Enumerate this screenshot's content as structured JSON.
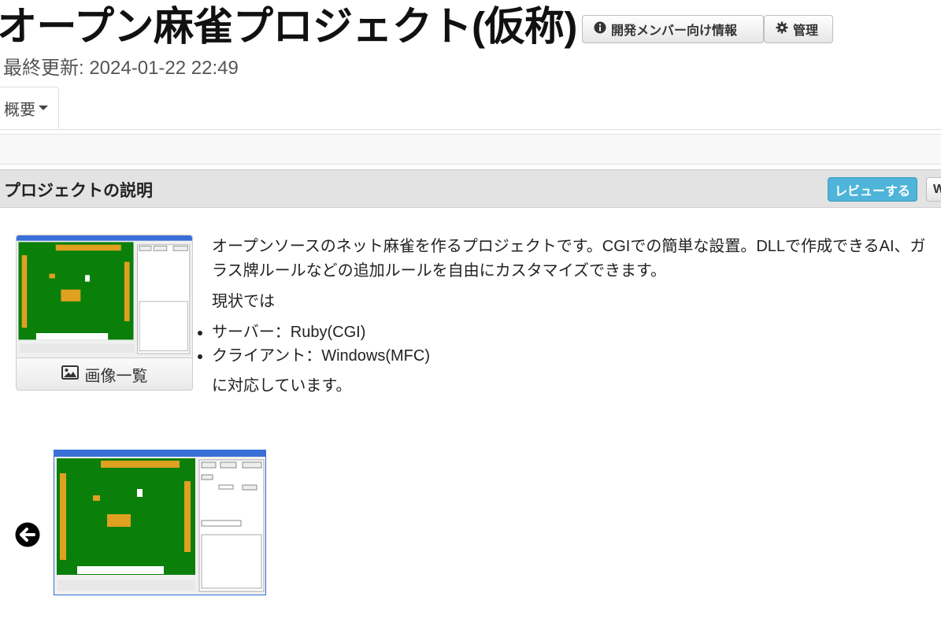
{
  "header": {
    "title": "オープン麻雀プロジェクト(仮称)",
    "dev_info_label": "開発メンバー向け情報",
    "admin_label": "管理",
    "last_updated": "最終更新: 2024-01-22 22:49"
  },
  "tabs": [
    {
      "label": "概要"
    }
  ],
  "panel": {
    "title": "プロジェクトの説明",
    "review_label": "レビューする",
    "w_label": "W"
  },
  "thumbnail": {
    "gallery_label": "画像一覧"
  },
  "description": {
    "para1": "オープンソースのネット麻雀を作るプロジェクトです。CGIでの簡単な設置。DLLで作成できるAI、ガラス牌ルールなどの追加ルールを自由にカスタマイズできます。",
    "para2": "現状では",
    "items": [
      "サーバー：Ruby(CGI)",
      "クライアント：Windows(MFC)"
    ],
    "para3": "に対応しています。"
  },
  "colors": {
    "accent": "#4fb4d9",
    "table_green": "#0a7f0a",
    "tile_orange": "#e0a020",
    "window_border": "#2f6fd6"
  },
  "icons": [
    "info-icon",
    "gear-icon",
    "picture-icon",
    "arrow-left-circle-icon"
  ]
}
